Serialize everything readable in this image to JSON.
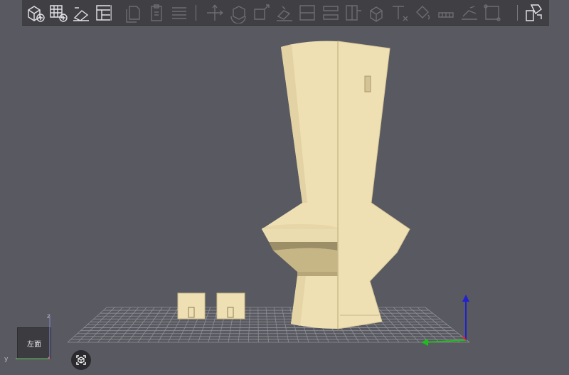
{
  "toolbar": {
    "groups": [
      {
        "buttons": [
          "add-part-icon",
          "add-plate-icon",
          "auto-arrange-icon",
          "layout-icon"
        ]
      },
      {
        "buttons": [
          "copy-icon",
          "paste-icon",
          "layers-icon"
        ]
      },
      {
        "buttons": [
          "move-icon",
          "rotate-icon",
          "scale-icon",
          "lay-on-face-icon",
          "cut-icon",
          "split-objects-icon",
          "split-parts-icon",
          "boolean-icon",
          "text-icon",
          "paint-icon",
          "seam-icon",
          "support-paint-icon",
          "measure-icon"
        ]
      },
      {
        "buttons": [
          "assembly-icon"
        ]
      }
    ]
  },
  "view_cube": {
    "face_label": "左面",
    "axis_z": "z",
    "axis_y": "y"
  },
  "colors": {
    "background": "#595961",
    "model": "#efe0b4",
    "model_shade": "#d8c796",
    "grid": "#8f8f96",
    "axis_x": "#d22",
    "axis_y": "#2c2",
    "axis_z": "#22c"
  }
}
